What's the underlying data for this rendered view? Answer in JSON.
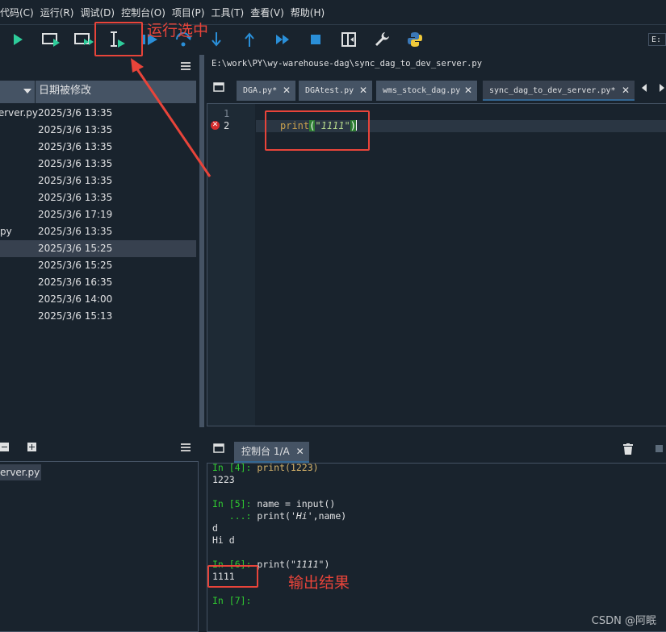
{
  "menu": [
    "代码(C)",
    "运行(R)",
    "调试(D)",
    "控制台(O)",
    "项目(P)",
    "工具(T)",
    "查看(V)",
    "帮助(H)"
  ],
  "toolbar": {
    "right_label": "E:"
  },
  "explorer": {
    "column_date": "日期被修改",
    "rows": [
      {
        "name": "erver.py",
        "date": "2025/3/6 13:35"
      },
      {
        "name": "",
        "date": "2025/3/6 13:35"
      },
      {
        "name": "",
        "date": "2025/3/6 13:35"
      },
      {
        "name": "",
        "date": "2025/3/6 13:35"
      },
      {
        "name": "",
        "date": "2025/3/6 13:35"
      },
      {
        "name": "",
        "date": "2025/3/6 13:35"
      },
      {
        "name": "",
        "date": "2025/3/6 17:19"
      },
      {
        "name": "py",
        "date": "2025/3/6 13:35"
      },
      {
        "name": "",
        "date": "2025/3/6 15:25"
      },
      {
        "name": "",
        "date": "2025/3/6 15:25"
      },
      {
        "name": "",
        "date": "2025/3/6 16:35"
      },
      {
        "name": "",
        "date": "2025/3/6 14:00"
      },
      {
        "name": "",
        "date": "2025/3/6 15:13"
      }
    ]
  },
  "left_bottom": {
    "item": "erver.py"
  },
  "editor": {
    "path": "E:\\work\\PY\\wy-warehouse-dag\\sync_dag_to_dev_server.py",
    "tabs": [
      "DGA.py*",
      "DGAtest.py",
      "wms_stock_dag.py",
      "sync_dag_to_dev_server.py*"
    ],
    "line_numbers": [
      "1",
      "2"
    ],
    "code_fn": "print",
    "code_open": "(",
    "code_str": "\"1111\"",
    "code_close": ")"
  },
  "console": {
    "tab": "控制台 1/A",
    "lines": {
      "l1_prompt": "In [4]: ",
      "l1_code": "print(1223)",
      "l2": "1223",
      "l3_prompt": "In [5]: ",
      "l3_code": "name = input()",
      "l4_cont": "   ...: ",
      "l4_code_a": "print(",
      "l4_code_str": "'Hi'",
      "l4_code_b": ",name)",
      "l5": "d",
      "l6": "Hi d",
      "l7_prompt": "In [6]: ",
      "l7_fn": "print(",
      "l7_str": "\"1111\"",
      "l7_close": ")",
      "l8": "1111",
      "l9_prompt": "In [7]:"
    }
  },
  "annotations": {
    "run_selection": "运行选中",
    "output_result": "输出结果"
  },
  "watermark": "CSDN @阿眠"
}
